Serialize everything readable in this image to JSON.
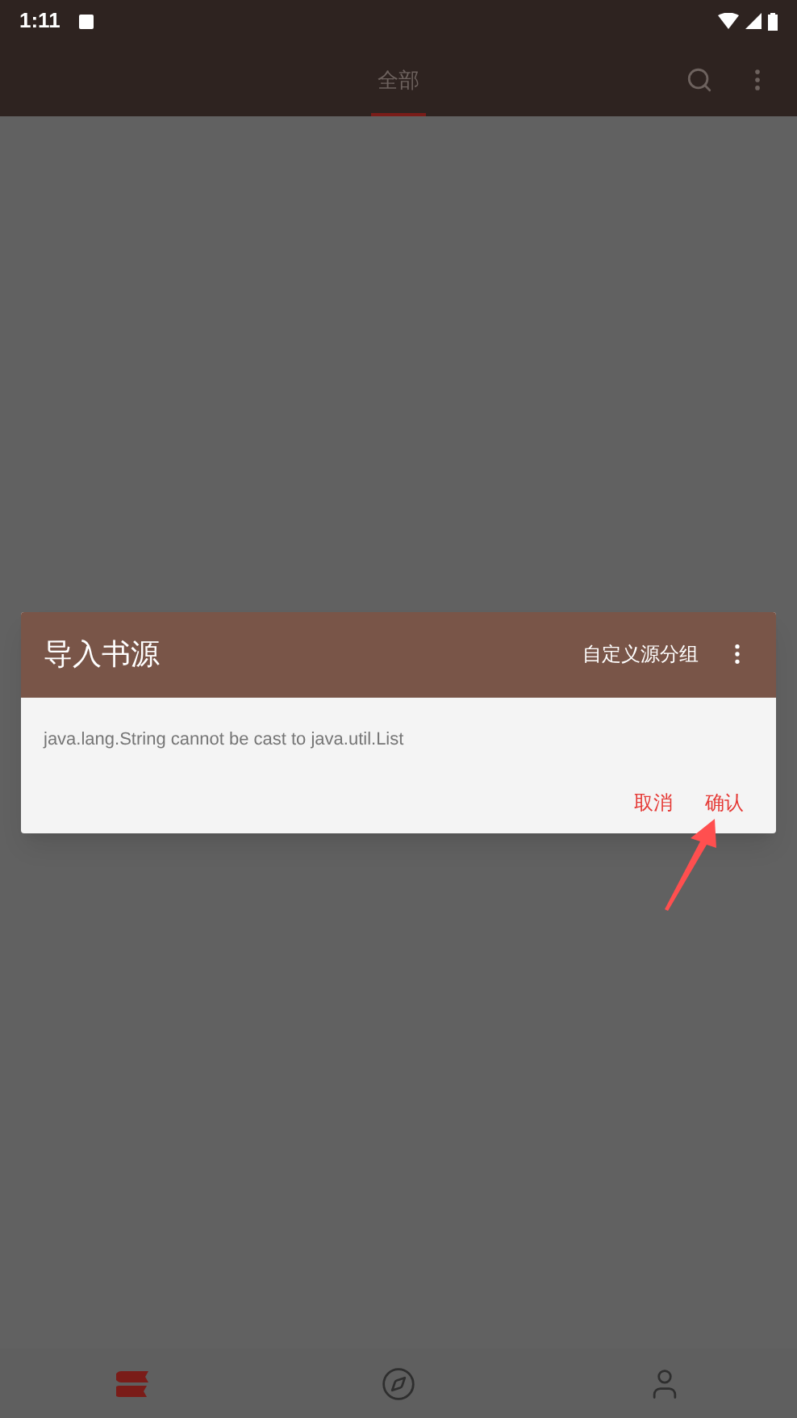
{
  "status_bar": {
    "time": "1:11"
  },
  "toolbar": {
    "tabs": [
      {
        "label": "全部",
        "selected": true
      }
    ]
  },
  "dialog": {
    "title": "导入书源",
    "action": "自定义源分组",
    "message": "java.lang.String cannot be cast to java.util.List",
    "buttons": [
      "取消",
      "确认"
    ]
  },
  "bottom_nav": [
    {
      "kind": "books",
      "selected": true
    },
    {
      "kind": "explore",
      "selected": false
    },
    {
      "kind": "profile",
      "selected": false
    }
  ]
}
